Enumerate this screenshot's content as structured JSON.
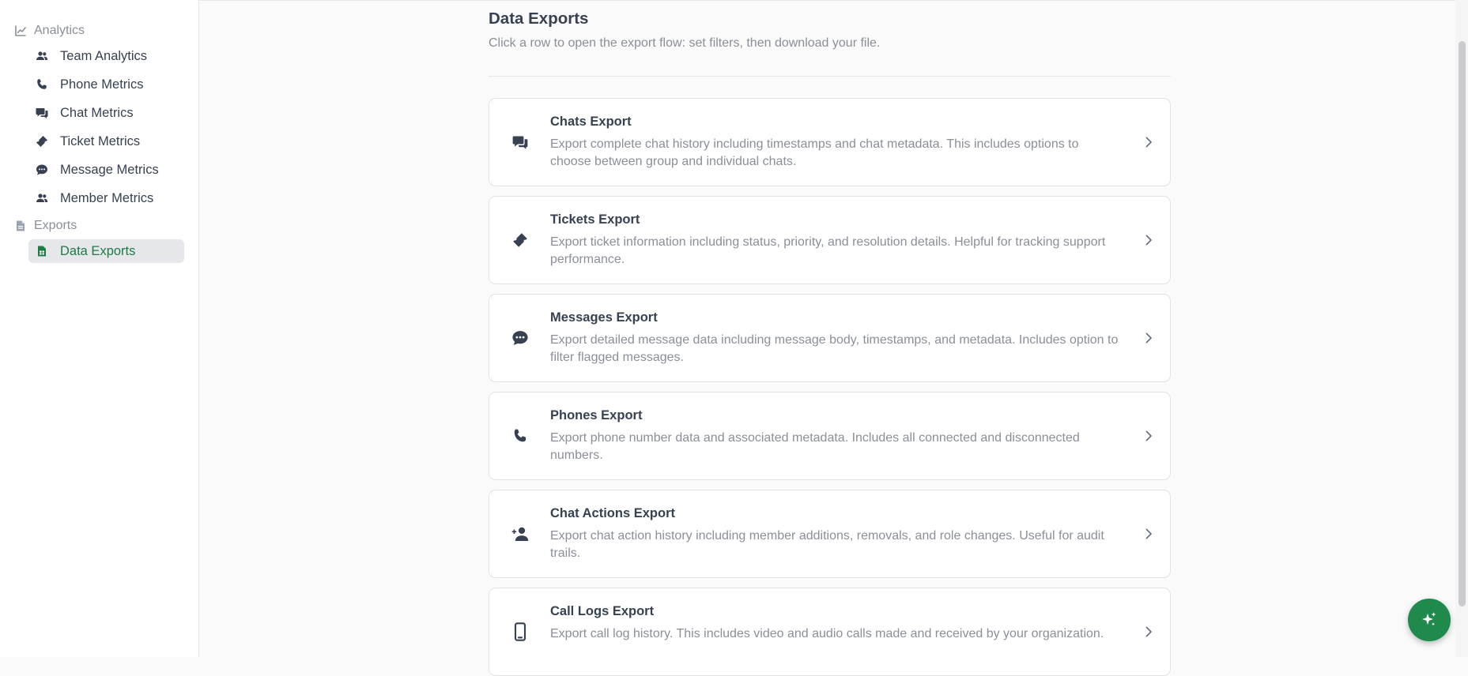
{
  "sidebar": {
    "sections": [
      {
        "label": "Analytics",
        "icon": "chart-line-icon"
      },
      {
        "label": "Exports",
        "icon": "document-icon"
      }
    ],
    "items": [
      {
        "label": "Team Analytics",
        "icon": "people-icon"
      },
      {
        "label": "Phone Metrics",
        "icon": "phone-icon"
      },
      {
        "label": "Chat Metrics",
        "icon": "chat-bubbles-icon"
      },
      {
        "label": "Ticket Metrics",
        "icon": "ticket-icon"
      },
      {
        "label": "Message Metrics",
        "icon": "message-icon"
      },
      {
        "label": "Member Metrics",
        "icon": "people-icon"
      },
      {
        "label": "Data Exports",
        "icon": "file-spreadsheet-icon",
        "active": true
      }
    ]
  },
  "main": {
    "title": "Data Exports",
    "subtitle": "Click a row to open the export flow: set filters, then download your file.",
    "cards": [
      {
        "title": "Chats Export",
        "description": "Export complete chat history including timestamps and chat metadata. This includes options to choose between group and individual chats.",
        "icon": "chat-bubbles-icon"
      },
      {
        "title": "Tickets Export",
        "description": "Export ticket information including status, priority, and resolution details. Helpful for tracking support performance.",
        "icon": "ticket-icon"
      },
      {
        "title": "Messages Export",
        "description": "Export detailed message data including message body, timestamps, and metadata. Includes option to filter flagged messages.",
        "icon": "message-icon"
      },
      {
        "title": "Phones Export",
        "description": "Export phone number data and associated metadata. Includes all connected and disconnected numbers.",
        "icon": "phone-icon"
      },
      {
        "title": "Chat Actions Export",
        "description": "Export chat action history including member additions, removals, and role changes. Useful for audit trails.",
        "icon": "person-add-icon"
      },
      {
        "title": "Call Logs Export",
        "description": "Export call log history. This includes video and audio calls made and received by your organization.",
        "icon": "mobile-phone-icon"
      }
    ]
  },
  "fab": {
    "icon": "sparkles-icon"
  },
  "colors": {
    "accent": "#1f8a4c",
    "active_text": "#1f7a44",
    "active_bg": "#e5e7eb",
    "muted_text": "#8a8f98",
    "body_text": "#374151"
  }
}
